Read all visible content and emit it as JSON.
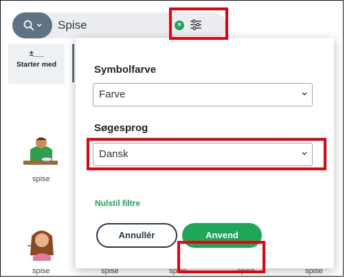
{
  "search": {
    "query": "Spise"
  },
  "sidebar": {
    "tab_glyph": "±___",
    "tab_label": "Starter med"
  },
  "results": {
    "caption": "spise"
  },
  "filter_panel": {
    "symbol_color_label": "Symbolfarve",
    "symbol_color_value": "Farve",
    "search_language_label": "Søgesprog",
    "search_language_value": "Dansk",
    "reset_label": "Nulstil filtre",
    "cancel_label": "Annullér",
    "apply_label": "Anvend"
  },
  "colors": {
    "accent_green": "#1ea65b",
    "highlight_red": "#e8000c",
    "search_button": "#5f7384"
  }
}
